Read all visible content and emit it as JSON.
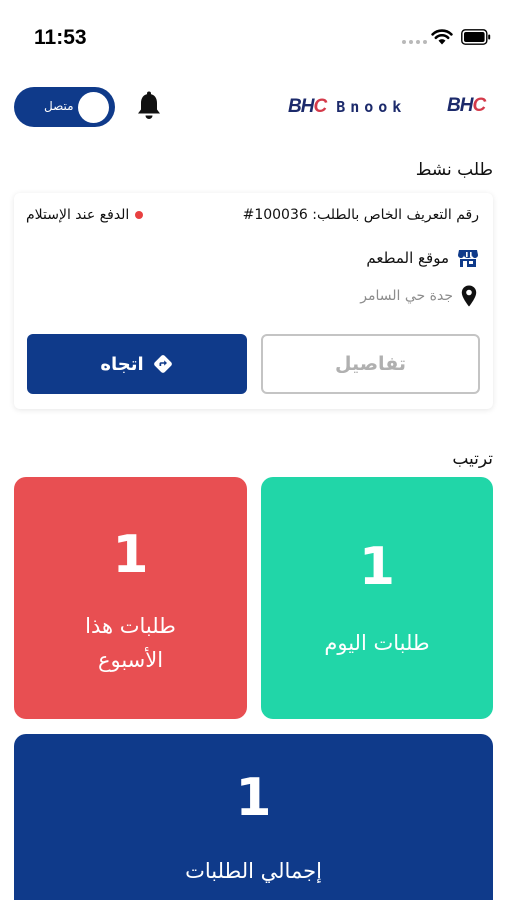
{
  "status_bar": {
    "time": "11:53"
  },
  "header": {
    "toggle_label": "متصل",
    "brand_logo": "BHC",
    "brand_name": "Bnook",
    "brand_logo_right": "BHC"
  },
  "active_order": {
    "section_title": "طلب نشط",
    "order_id_text": "رقم التعريف الخاص بالطلب: 100036#",
    "payment_method": "الدفع عند الإستلام",
    "store_label": "موقع المطعم",
    "location": "جدة حي السامر",
    "details_button": "تفاصيل",
    "direction_button": "اتجاه"
  },
  "stats": {
    "section_title": "ترتيب",
    "today": {
      "value": "1",
      "label": "طلبات اليوم"
    },
    "week": {
      "value": "1",
      "label_line1": "طلبات هذا",
      "label_line2": "الأسبوع"
    },
    "total": {
      "value": "1",
      "label": "إجمالي الطلبات"
    }
  },
  "colors": {
    "primary": "#0f3a8a",
    "today_card": "#21d6a8",
    "week_card": "#e84f52",
    "payment_dot": "#e84040"
  },
  "icons": [
    "wifi-icon",
    "battery-icon",
    "bell-icon",
    "store-icon",
    "pin-icon",
    "direction-icon"
  ]
}
